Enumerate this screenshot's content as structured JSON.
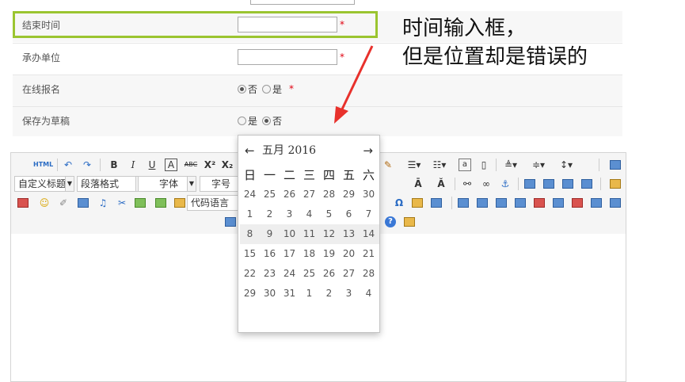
{
  "form": {
    "rows": [
      {
        "label": "结束时间",
        "type": "text",
        "value": "",
        "required": "*"
      },
      {
        "label": "承办单位",
        "type": "text",
        "value": "",
        "required": "*"
      },
      {
        "label": "在线报名",
        "type": "radio",
        "options": [
          "否",
          "是"
        ],
        "selected": "否",
        "required": "*"
      },
      {
        "label": "保存为草稿",
        "type": "radio",
        "options": [
          "是",
          "否"
        ],
        "selected": "否"
      }
    ]
  },
  "annotation": {
    "line1": "时间输入框，",
    "line2": "但是位置却是错误的",
    "highlight_color": "#9bc530",
    "arrow_color": "#e8312c"
  },
  "toolbar": {
    "html_label": "HTML",
    "bold": "B",
    "italic": "I",
    "underline": "U",
    "font_border": "A",
    "strike": "ABC",
    "superscript": "X²",
    "subscript": "X₂",
    "custom_title": "自定义标题",
    "paragraph": "段落格式",
    "font_family": "字体",
    "font_size": "字号",
    "code_language": "代码语言",
    "omega": "Ω",
    "help": "?"
  },
  "datepicker": {
    "prev": "←",
    "next": "→",
    "title": "五月 2016",
    "weekdays": [
      "日",
      "一",
      "二",
      "三",
      "四",
      "五",
      "六"
    ],
    "weeks": [
      [
        "24",
        "25",
        "26",
        "27",
        "28",
        "29",
        "30"
      ],
      [
        "1",
        "2",
        "3",
        "4",
        "5",
        "6",
        "7"
      ],
      [
        "8",
        "9",
        "10",
        "11",
        "12",
        "13",
        "14"
      ],
      [
        "15",
        "16",
        "17",
        "18",
        "19",
        "20",
        "21"
      ],
      [
        "22",
        "23",
        "24",
        "25",
        "26",
        "27",
        "28"
      ],
      [
        "29",
        "30",
        "31",
        "1",
        "2",
        "3",
        "4"
      ]
    ]
  }
}
